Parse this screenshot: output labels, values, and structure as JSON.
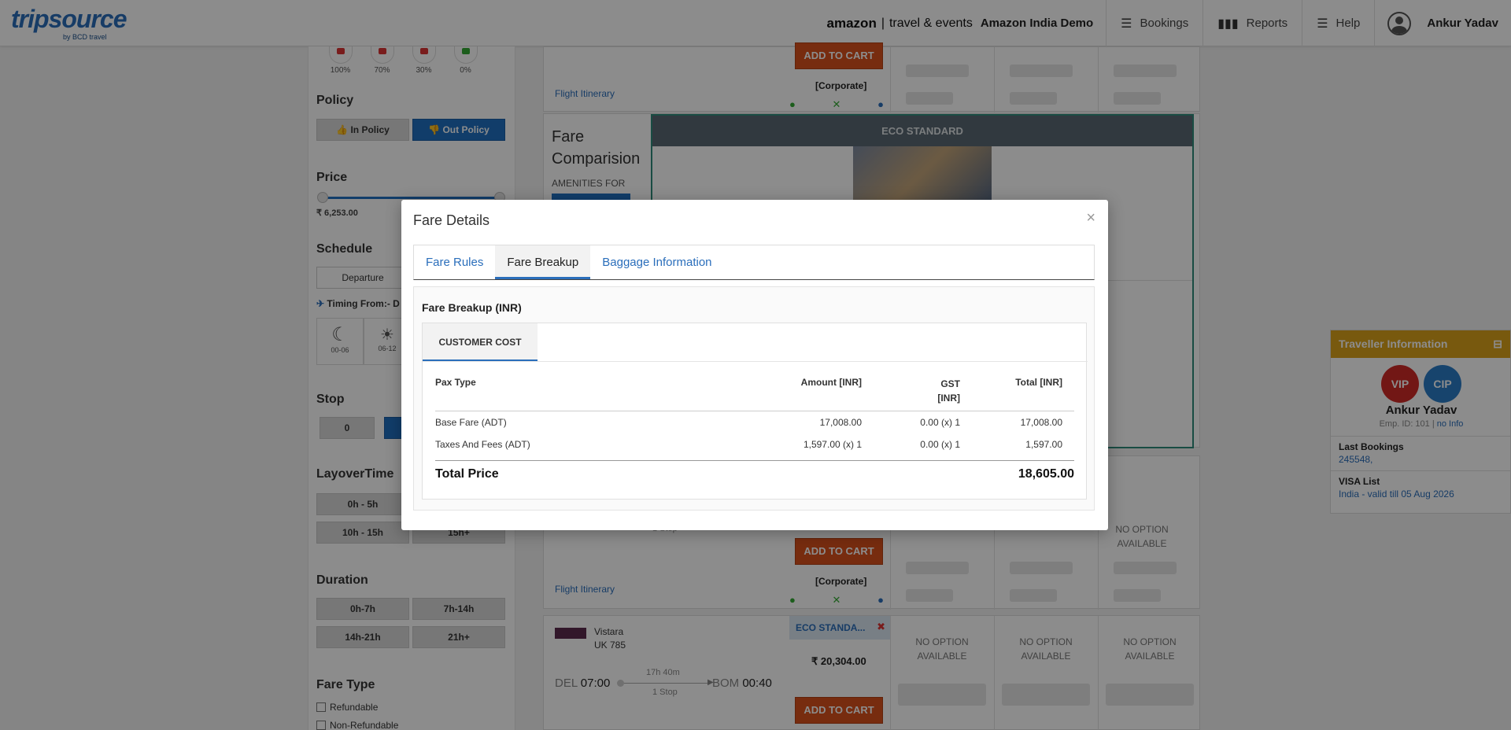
{
  "header": {
    "logo": "tripsource",
    "logo_sub": "by BCD travel",
    "brand_amazon": "amazon",
    "brand_tail": "travel & events",
    "client": "Amazon India Demo",
    "nav": [
      {
        "label": "Bookings",
        "icon": "menu-icon"
      },
      {
        "label": "Reports",
        "icon": "bar-chart-icon"
      },
      {
        "label": "Help",
        "icon": "menu-icon"
      }
    ],
    "user": "Ankur Yadav"
  },
  "filters": {
    "policy_pcts": [
      "100%",
      "70%",
      "30%",
      "0%"
    ],
    "policy_title": "Policy",
    "in_policy": "In Policy",
    "out_policy": "Out Policy",
    "price_title": "Price",
    "price_min": "₹ 6,253.00",
    "schedule_title": "Schedule",
    "departure": "Departure",
    "timing_from": "Timing From:- D",
    "tod_labels": [
      "00-06",
      "06-12"
    ],
    "stop_title": "Stop",
    "stop_zero": "0",
    "layover_title": "LayoverTime",
    "layover_opts": [
      "0h - 5h",
      "10h - 15h",
      "15h+"
    ],
    "duration_title": "Duration",
    "duration_opts": [
      "0h-7h",
      "7h-14h",
      "14h-21h",
      "21h+"
    ],
    "fare_type_title": "Fare Type",
    "refundable": "Refundable",
    "non_refundable": "Non-Refundable"
  },
  "results": {
    "add_to_cart": "ADD TO CART",
    "corporate": "[Corporate]",
    "flight_itinerary": "Flight Itinerary",
    "fare_comparison": "Fare Comparision",
    "amenities_for": "AMENITIES FOR",
    "eco_standard": "ECO STANDARD",
    "no_option": "NO OPTION AVAILABLE",
    "one_stop": "1 Stop",
    "vistara": {
      "airline": "Vistara",
      "flight": "UK 785",
      "from": "DEL",
      "dep": "07:00",
      "duration": "17h 40m",
      "stops": "1 Stop",
      "to": "BOM",
      "arr": "00:40",
      "fare_name": "ECO STANDA...",
      "price": "₹ 20,304.00"
    }
  },
  "modal": {
    "title": "Fare Details",
    "close": "×",
    "tabs": [
      "Fare Rules",
      "Fare Breakup",
      "Baggage Information"
    ],
    "active_tab": "Fare Breakup",
    "breakup_title": "Fare Breakup (INR)",
    "cost_tab": "CUSTOMER COST",
    "columns": {
      "pax": "Pax Type",
      "amount": "Amount [INR]",
      "gst": "GST [INR]",
      "total": "Total [INR]"
    },
    "rows": [
      {
        "pax": "Base Fare (ADT)",
        "amount": "17,008.00",
        "gst": "0.00 (x) 1",
        "total": "17,008.00"
      },
      {
        "pax": "Taxes And Fees (ADT)",
        "amount": "1,597.00 (x) 1",
        "gst": "0.00 (x) 1",
        "total": "1,597.00"
      }
    ],
    "total_label": "Total Price",
    "total_value": "18,605.00"
  },
  "traveller": {
    "title": "Traveller Information",
    "minimize": "⊟",
    "badges": [
      "VIP",
      "CIP"
    ],
    "name": "Ankur Yadav",
    "emp": "Emp. ID: 101 |",
    "no_info": "no Info",
    "last_bookings_label": "Last Bookings",
    "last_bookings_value": "245548,",
    "visa_label": "VISA List",
    "visa_value": "India - valid till 05 Aug 2026"
  },
  "colors": {
    "primary_blue": "#2a6ebb",
    "cart_orange": "#d9501c",
    "traveller_gold": "#dba21a",
    "vip_red": "#cf2a27",
    "cip_blue": "#2a7cc7"
  }
}
